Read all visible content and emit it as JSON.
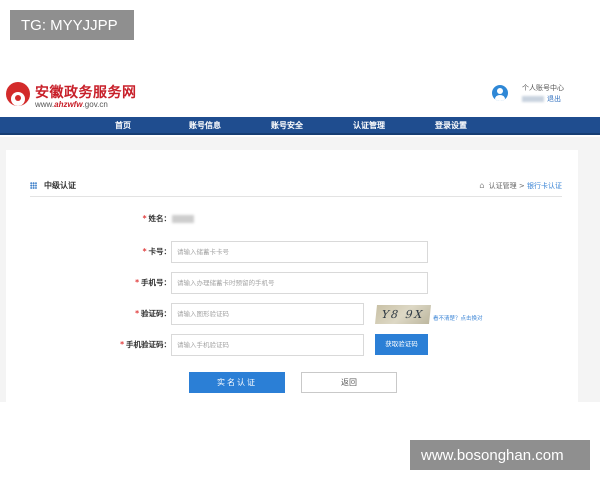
{
  "watermarks": {
    "top": "TG: MYYJJPP",
    "bottom": "www.bosonghan.com"
  },
  "header": {
    "site_title": "安徽政务服务网",
    "site_url_prefix": "www.",
    "site_url_domain": "ahzwfw",
    "site_url_suffix": ".gov.cn",
    "user_center": "个人账号中心",
    "logout": "退出"
  },
  "nav": {
    "items": [
      {
        "label": "首页"
      },
      {
        "label": "账号信息"
      },
      {
        "label": "账号安全"
      },
      {
        "label": "认证管理"
      },
      {
        "label": "登录设置"
      }
    ]
  },
  "panel": {
    "title": "中级认证",
    "breadcrumb": {
      "parent": "认证管理",
      "separator": ">",
      "current": "银行卡认证"
    }
  },
  "form": {
    "required_mark": "*",
    "name": {
      "label": "姓名："
    },
    "card": {
      "label": "卡号：",
      "placeholder": "请输入储蓄卡卡号"
    },
    "phone": {
      "label": "手机号：",
      "placeholder": "请输入办理储蓄卡时预留的手机号"
    },
    "captcha": {
      "label": "验证码：",
      "placeholder": "请输入图形验证码",
      "image_text": "Y8 9X",
      "refresh_link": "看不清楚？点击换对"
    },
    "sms": {
      "label": "手机验证码：",
      "placeholder": "请输入手机验证码",
      "button": "获取验证码"
    },
    "submit": "实名认证",
    "back": "返回"
  },
  "colors": {
    "brand_red": "#c8202a",
    "nav_blue": "#1f4d8f",
    "accent_blue": "#2b7fd6",
    "required_red": "#e03c3c"
  }
}
